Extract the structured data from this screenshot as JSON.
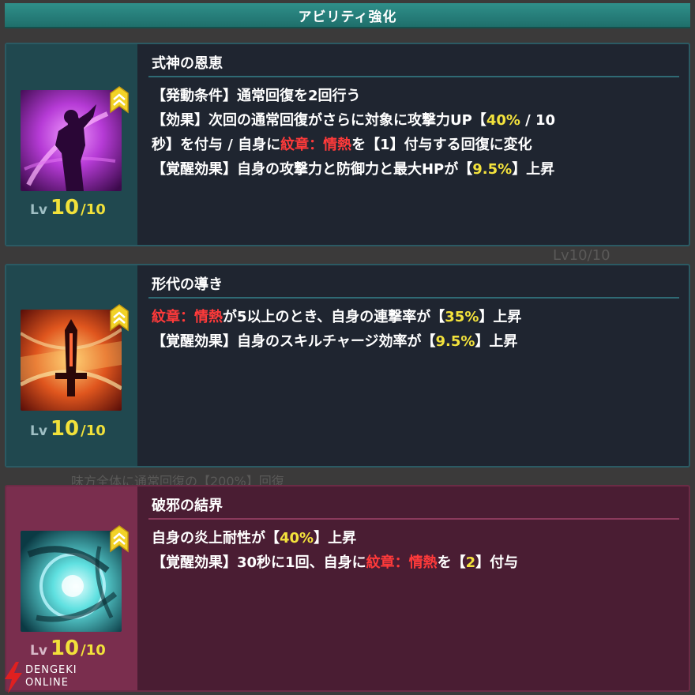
{
  "header": {
    "title": "アビリティ強化"
  },
  "background": {
    "ghost_lv": "Lv10/10",
    "ghost_text": "味方全体に通常回復の【200%】回復"
  },
  "abilities": [
    {
      "name": "式神の恩恵",
      "level": {
        "prefix": "Lv",
        "current": "10",
        "separator": "/",
        "max": "10"
      },
      "icon": "shadow-figure-icon",
      "lines": [
        {
          "segments": [
            {
              "t": "【発動条件】通常回復を2回行う"
            }
          ]
        },
        {
          "segments": [
            {
              "t": "【効果】次回の通常回復がさらに対象に攻撃力UP【"
            },
            {
              "t": "40%",
              "c": "y"
            },
            {
              "t": " / 10"
            }
          ]
        },
        {
          "segments": [
            {
              "t": "秒】を付与 / 自身に"
            },
            {
              "t": "紋章：情熱",
              "c": "r"
            },
            {
              "t": "を【1】付与する回復に変化"
            }
          ]
        },
        {
          "segments": [
            {
              "t": "【覚醒効果】自身の攻撃力と防御力と最大HPが【"
            },
            {
              "t": "9.5%",
              "c": "y"
            },
            {
              "t": "】上昇"
            }
          ]
        }
      ]
    },
    {
      "name": "形代の導き",
      "level": {
        "prefix": "Lv",
        "current": "10",
        "separator": "/",
        "max": "10"
      },
      "icon": "sword-icon",
      "lines": [
        {
          "segments": [
            {
              "t": "紋章：情熱",
              "c": "r"
            },
            {
              "t": "が5以上のとき、自身の連撃率が【"
            },
            {
              "t": "35%",
              "c": "y"
            },
            {
              "t": "】上昇"
            }
          ]
        },
        {
          "segments": [
            {
              "t": "【覚醒効果】自身のスキルチャージ効率が【"
            },
            {
              "t": "9.5%",
              "c": "y"
            },
            {
              "t": "】上昇"
            }
          ]
        }
      ]
    },
    {
      "name": "破邪の結界",
      "level": {
        "prefix": "Lv",
        "current": "10",
        "separator": "/",
        "max": "10"
      },
      "icon": "barrier-orb-icon",
      "lines": [
        {
          "segments": [
            {
              "t": "自身の炎上耐性が【"
            },
            {
              "t": "40%",
              "c": "y"
            },
            {
              "t": "】上昇"
            }
          ]
        },
        {
          "segments": [
            {
              "t": "【覚醒効果】30秒に1回、自身に"
            },
            {
              "t": "紋章：情熱",
              "c": "r"
            },
            {
              "t": "を【"
            },
            {
              "t": "2",
              "c": "y"
            },
            {
              "t": "】付与"
            }
          ]
        }
      ]
    }
  ],
  "watermark": {
    "line1": "DENGEKI",
    "line2": "ONLINE"
  },
  "colors": {
    "highlight_yellow": "#f3e23c",
    "highlight_red": "#ff3a3a",
    "accent_teal": "#2f8f8a"
  }
}
